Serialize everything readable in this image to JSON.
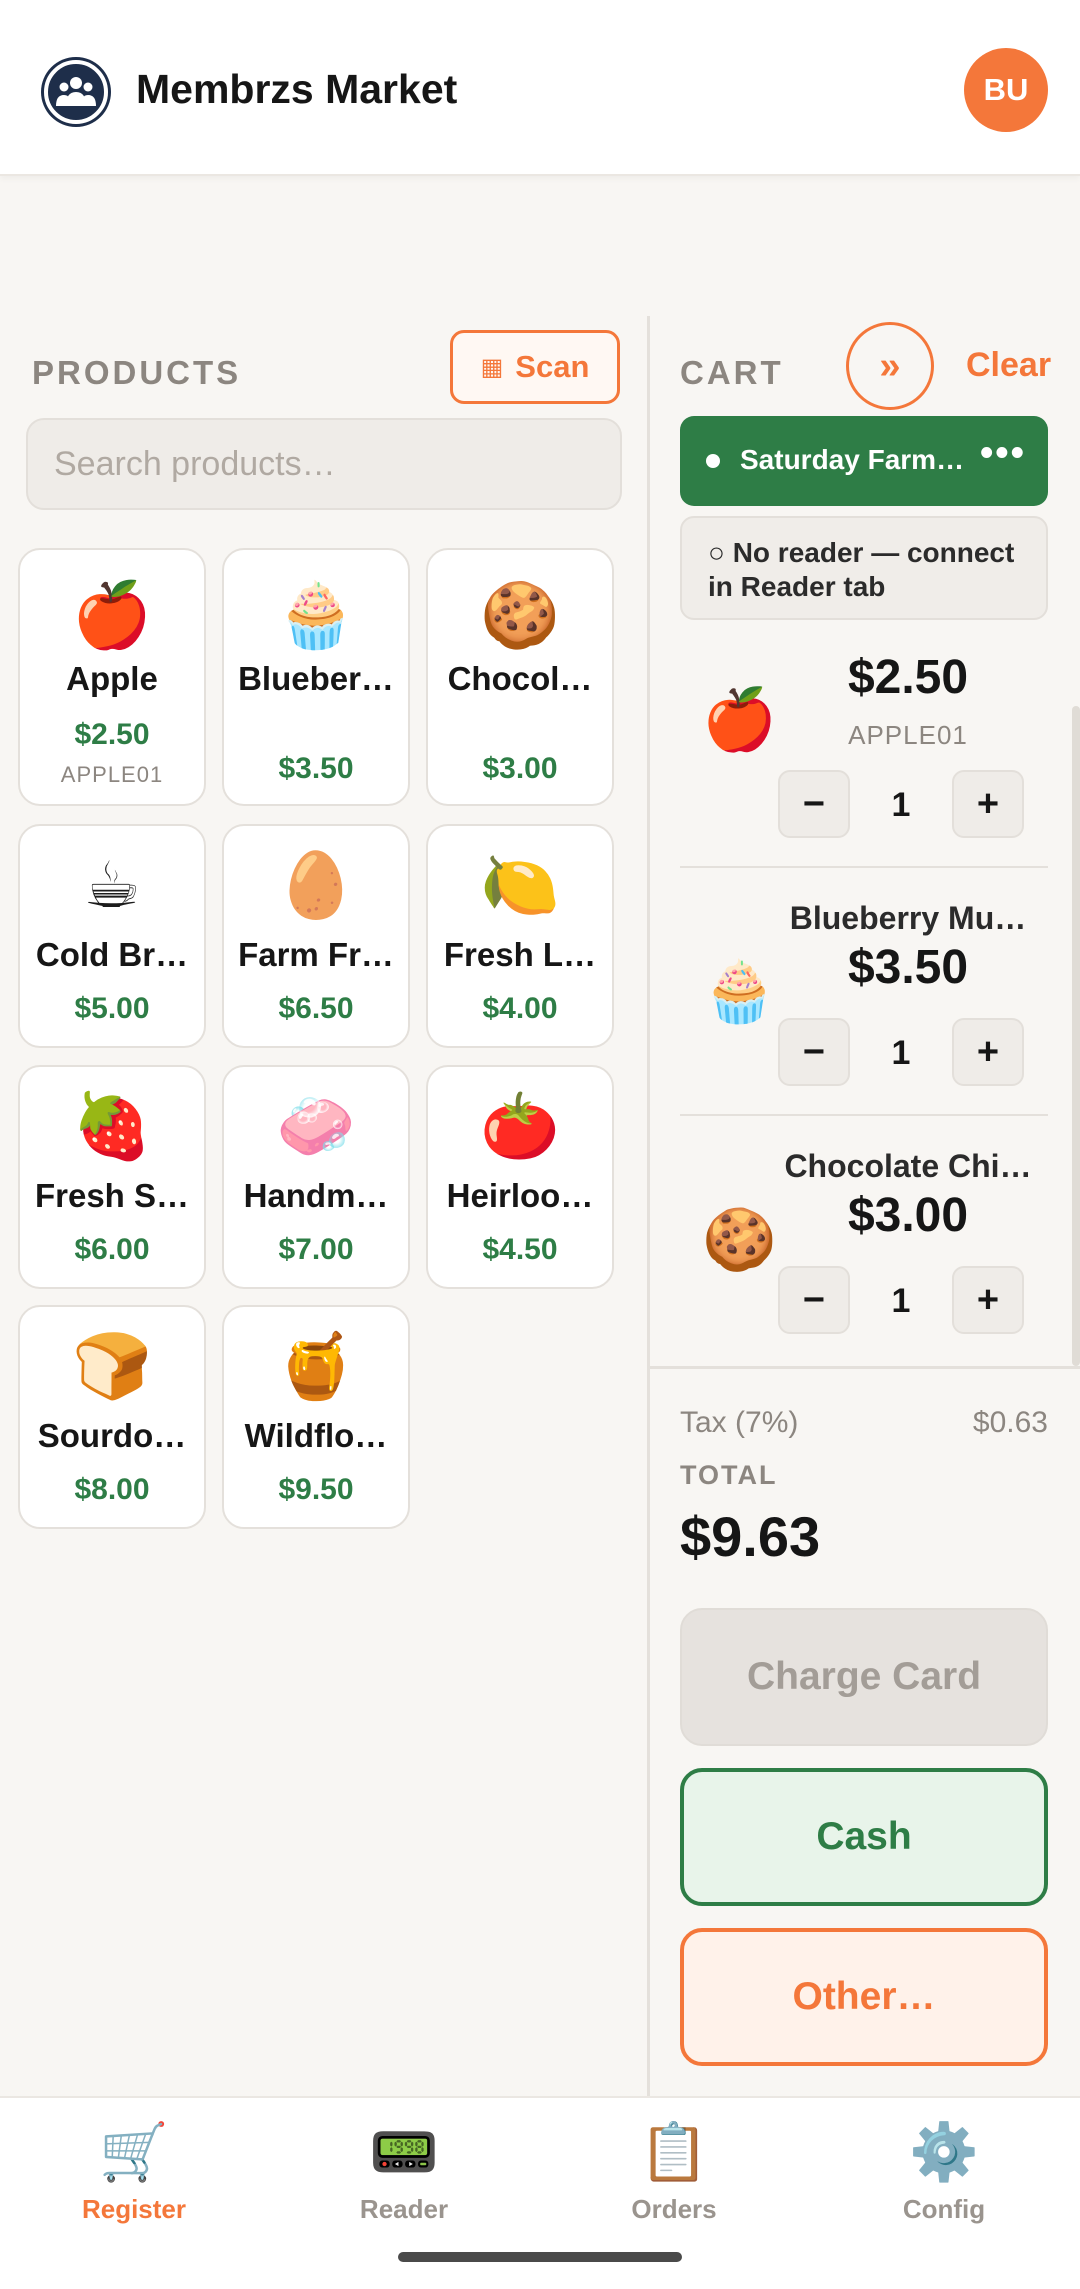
{
  "header": {
    "app_title": "Membrzs Market",
    "avatar_initials": "BU",
    "logo_icon": "team-people-icon"
  },
  "products": {
    "section_label": "PRODUCTS",
    "scan_label": "Scan",
    "scan_icon": "barcode-scan-icon",
    "search_placeholder": "Search products…",
    "items": [
      {
        "emoji": "🍎",
        "name": "Apple",
        "price": "$2.50",
        "sku": "APPLE01"
      },
      {
        "emoji": "🧁",
        "name": "Blueber…",
        "price": "$3.50"
      },
      {
        "emoji": "🍪",
        "name": "Chocol…",
        "price": "$3.00"
      },
      {
        "emoji": "☕",
        "name": "Cold Br…",
        "price": "$5.00"
      },
      {
        "emoji": "🥚",
        "name": "Farm Fr…",
        "price": "$6.50"
      },
      {
        "emoji": "🍋",
        "name": "Fresh L…",
        "price": "$4.00"
      },
      {
        "emoji": "🍓",
        "name": "Fresh S…",
        "price": "$6.00"
      },
      {
        "emoji": "🧼",
        "name": "Handm…",
        "price": "$7.00"
      },
      {
        "emoji": "🍅",
        "name": "Heirloo…",
        "price": "$4.50"
      },
      {
        "emoji": "🍞",
        "name": "Sourdo…",
        "price": "$8.00"
      },
      {
        "emoji": "🍯",
        "name": "Wildflo…",
        "price": "$9.50"
      }
    ]
  },
  "cart": {
    "section_label": "CART",
    "collapse_label": "»",
    "clear_label": "Clear",
    "event_name": "Saturday Farm …",
    "event_more": "•••",
    "reader_status": "○ No reader — connect in Reader tab",
    "items": [
      {
        "emoji": "🍎",
        "name": "",
        "price": "$2.50",
        "sku": "APPLE01",
        "qty": "1"
      },
      {
        "emoji": "🧁",
        "name": "Blueberry Mu…",
        "price": "$3.50",
        "qty": "1"
      },
      {
        "emoji": "🍪",
        "name": "Chocolate Chi…",
        "price": "$3.00",
        "qty": "1"
      }
    ],
    "minus_label": "−",
    "plus_label": "+",
    "tax_label": "Tax (7%)",
    "tax_value": "$0.63",
    "total_label": "TOTAL",
    "total_value": "$9.63",
    "charge_card_label": "Charge Card",
    "cash_label": "Cash",
    "other_label": "Other…"
  },
  "nav": {
    "active": "Register",
    "items": [
      {
        "icon": "🛒",
        "label": "Register"
      },
      {
        "icon": "📟",
        "label": "Reader"
      },
      {
        "icon": "📋",
        "label": "Orders"
      },
      {
        "icon": "⚙️",
        "label": "Config"
      }
    ]
  },
  "colors": {
    "accent": "#f4773a",
    "green": "#2e7d46",
    "background": "#f8f6f3"
  }
}
